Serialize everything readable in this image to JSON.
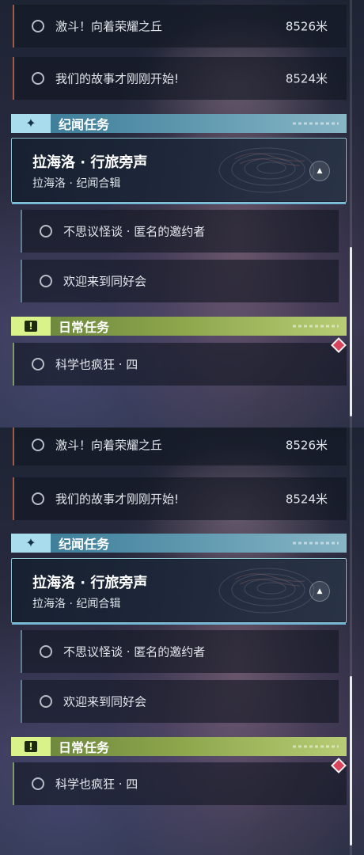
{
  "panels": [
    {
      "pinned_quests": [
        {
          "title": "激斗！向着荣耀之丘",
          "distance": "8526米"
        },
        {
          "title": "我们的故事才刚刚开始!",
          "distance": "8524米"
        }
      ],
      "story_section": {
        "label": "纪闻任务",
        "badge_icon": "sparkle-icon",
        "accent": "#a9ddee",
        "card": {
          "title": "拉海洛 · 行旅旁声",
          "subtitle": "拉海洛 · 纪闻合辑"
        },
        "items": [
          {
            "title": "不思议怪谈 · 匿名的邀约者"
          },
          {
            "title": "欢迎来到同好会"
          }
        ]
      },
      "daily_section": {
        "label": "日常任务",
        "badge_icon": "alert-icon",
        "accent": "#d9f28a",
        "items": [
          {
            "title": "科学也疯狂 · 四"
          }
        ]
      }
    },
    {
      "pinned_quests": [
        {
          "title": "激斗！向着荣耀之丘",
          "distance": "8526米"
        },
        {
          "title": "我们的故事才刚刚开始!",
          "distance": "8524米"
        }
      ],
      "story_section": {
        "label": "纪闻任务",
        "badge_icon": "sparkle-icon",
        "accent": "#a9ddee",
        "card": {
          "title": "拉海洛 · 行旅旁声",
          "subtitle": "拉海洛 · 纪闻合辑"
        },
        "items": [
          {
            "title": "不思议怪谈 · 匿名的邀约者"
          },
          {
            "title": "欢迎来到同好会"
          }
        ]
      },
      "daily_section": {
        "label": "日常任务",
        "badge_icon": "alert-icon",
        "accent": "#d9f28a",
        "items": [
          {
            "title": "科学也疯狂 · 四"
          }
        ]
      }
    }
  ]
}
